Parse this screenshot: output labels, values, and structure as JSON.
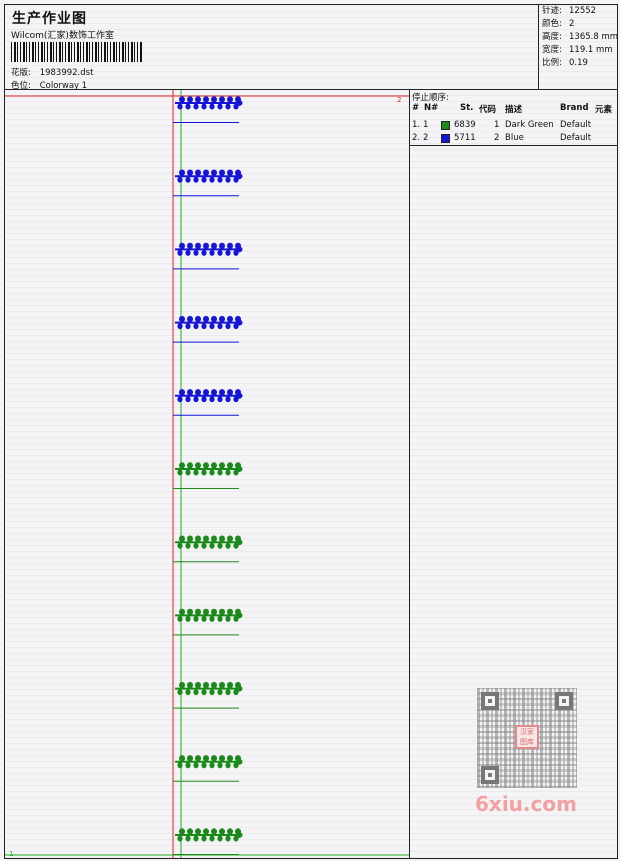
{
  "header": {
    "title": "生产作业图",
    "company": "Wilcom(汇家)数饰工作室",
    "design_label": "花版:",
    "design_value": "1983992.dst",
    "colorway_label": "色位:",
    "colorway_value": "Colorway 1"
  },
  "stats": [
    {
      "label": "针迹:",
      "value": "12552"
    },
    {
      "label": "颜色:",
      "value": "2"
    },
    {
      "label": "高度:",
      "value": "1365.8 mm"
    },
    {
      "label": "宽度:",
      "value": "119.1 mm"
    },
    {
      "label": "比例:",
      "value": "0.19"
    }
  ],
  "stop_sequence": {
    "caption": "停止顺序:",
    "columns": [
      "#",
      "N#",
      "St.",
      "代码",
      "描述",
      "Brand",
      "元素"
    ],
    "rows": [
      {
        "idx": "1.",
        "n": "1",
        "color": "#1a8a1a",
        "stitches": "6839",
        "code": "1",
        "desc": "Dark Green",
        "brand": "Default"
      },
      {
        "idx": "2.",
        "n": "2",
        "color": "#1515d8",
        "stitches": "5711",
        "code": "2",
        "desc": "Blue",
        "brand": "Default"
      }
    ]
  },
  "design_marks": {
    "start_marker": "2",
    "end_marker": "1"
  },
  "sprigs": [
    {
      "color": "#1515d8"
    },
    {
      "color": "#1515d8"
    },
    {
      "color": "#1515d8"
    },
    {
      "color": "#1515d8"
    },
    {
      "color": "#1515d8"
    },
    {
      "color": "#1a8a1a"
    },
    {
      "color": "#1a8a1a"
    },
    {
      "color": "#1a8a1a"
    },
    {
      "color": "#1a8a1a"
    },
    {
      "color": "#1a8a1a"
    },
    {
      "color": "#1a8a1a"
    }
  ],
  "watermark": {
    "seal_text": "汉家图库",
    "brand": "6xiu.com"
  }
}
